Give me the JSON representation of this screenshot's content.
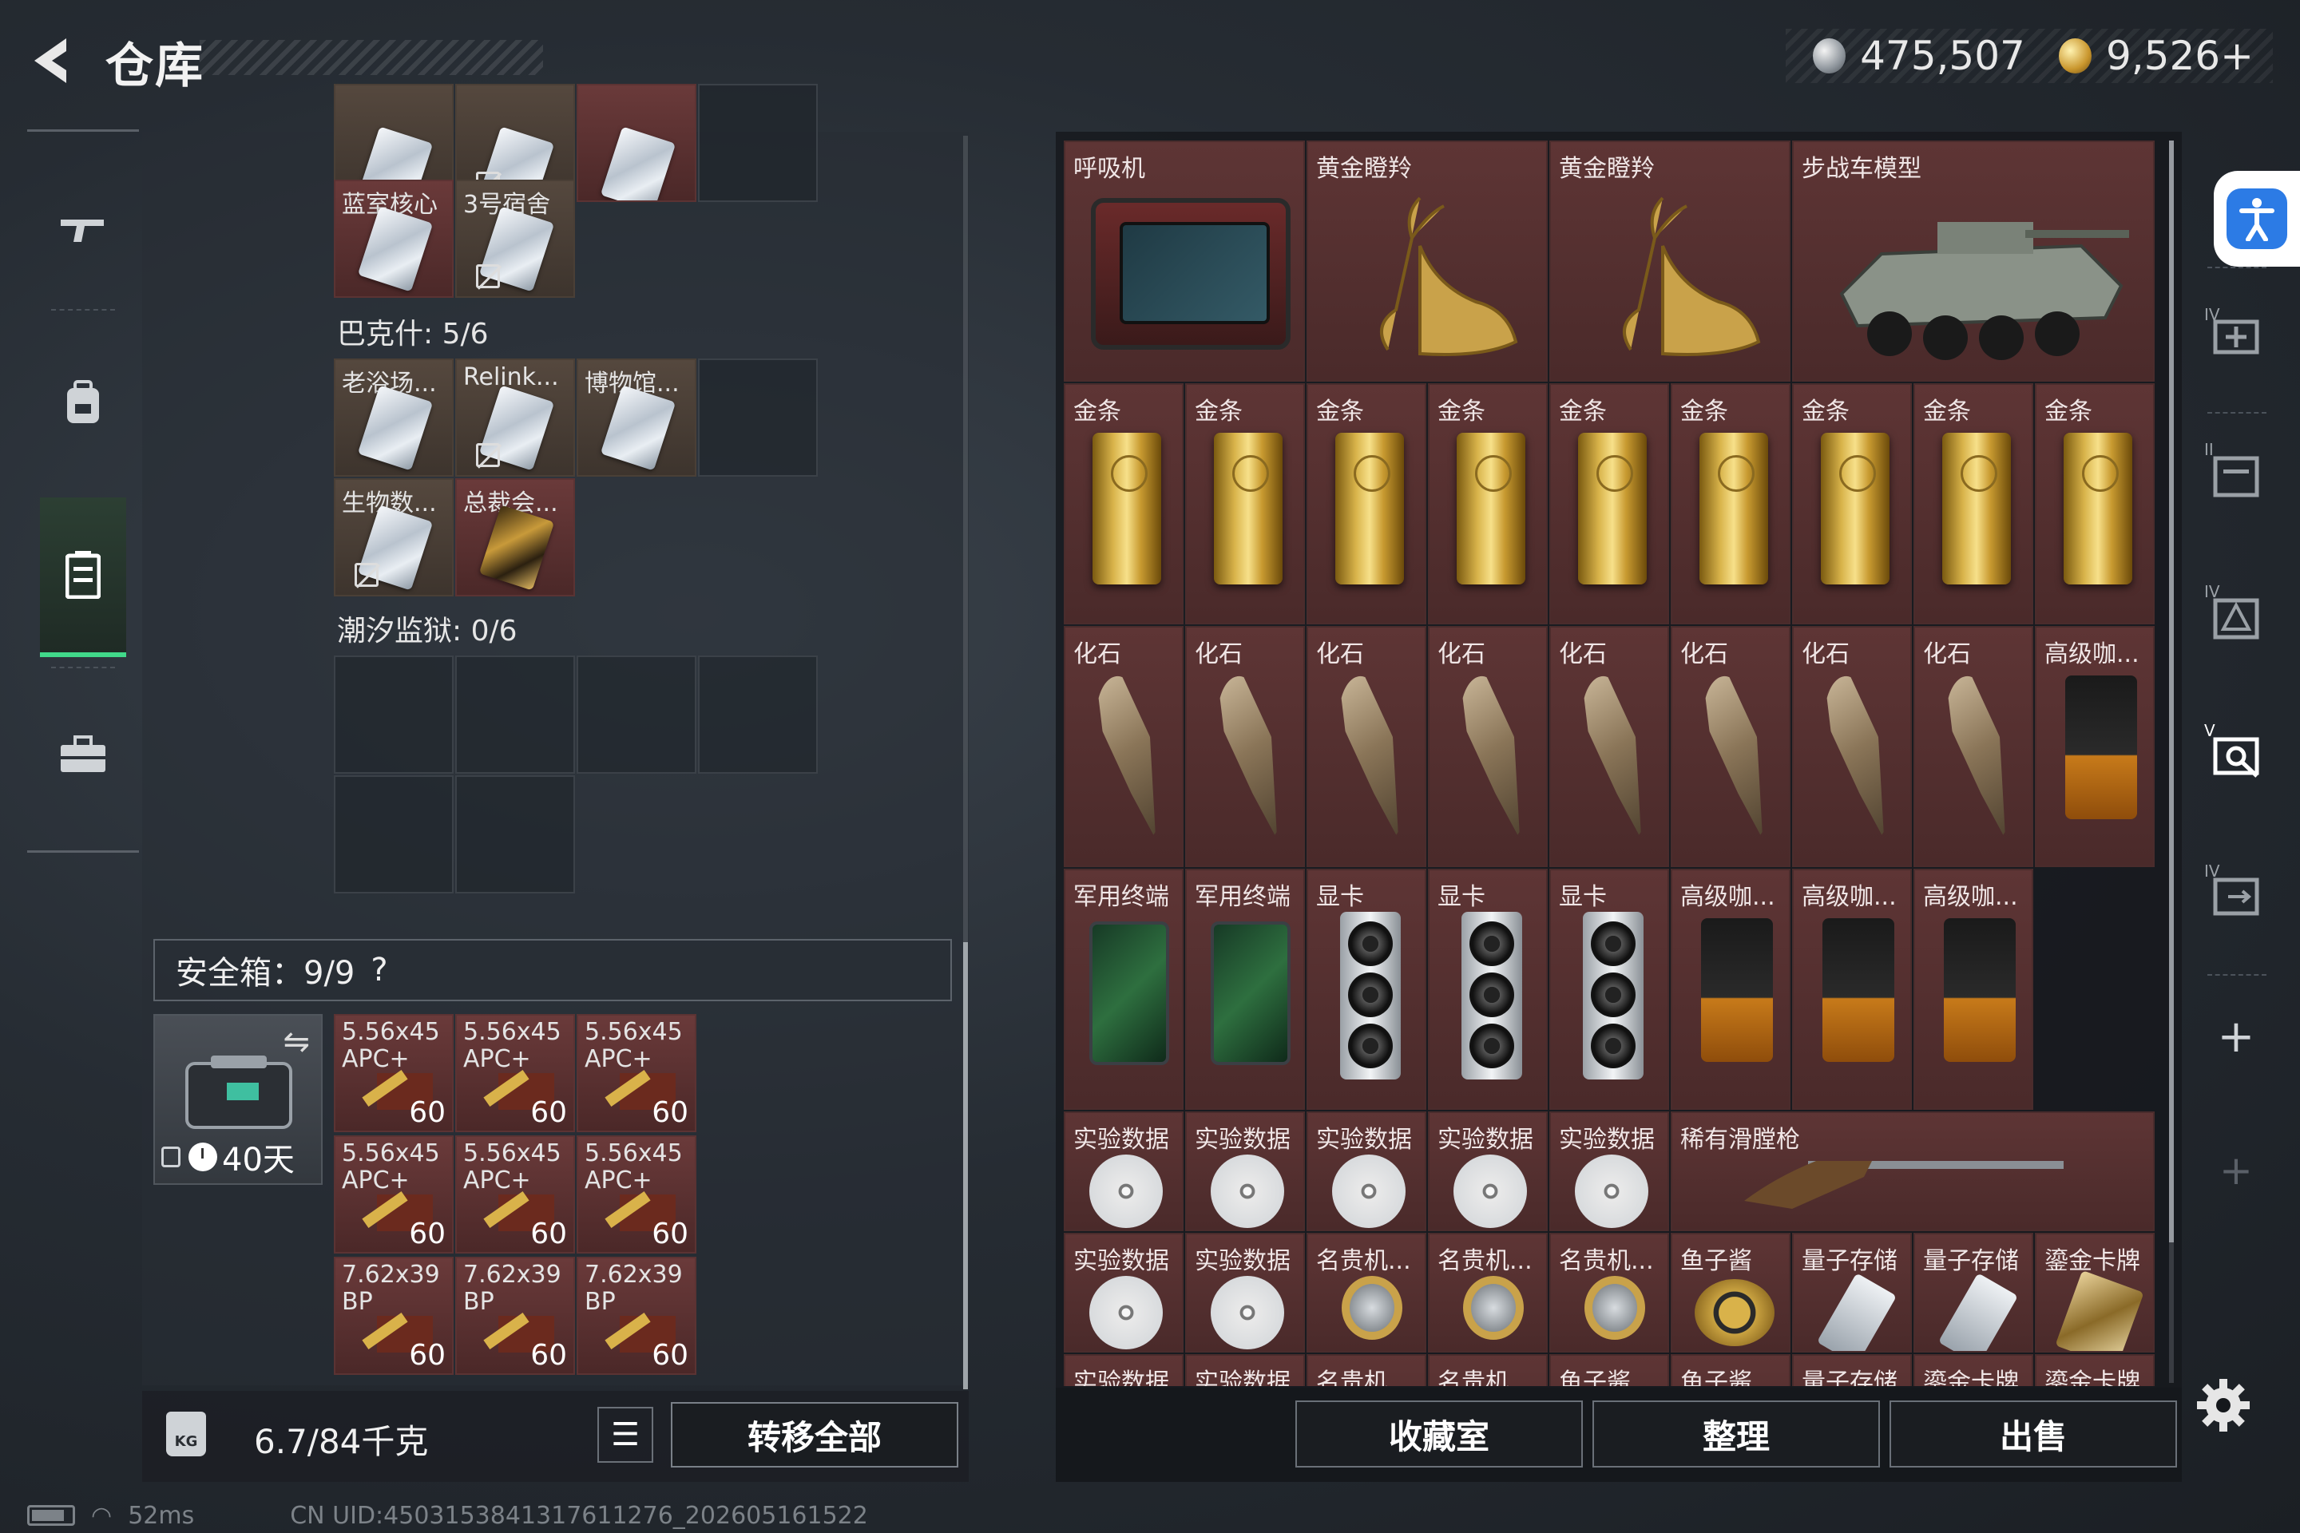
{
  "header": {
    "title": "仓库",
    "currency": [
      {
        "icon": "silver-coin-icon",
        "value": "475,507"
      },
      {
        "icon": "gold-coin-icon",
        "value": "9,526+"
      }
    ]
  },
  "nav": [
    "gun-icon",
    "backpack-icon",
    "locker-icon",
    "briefcase-icon"
  ],
  "backpack": {
    "top_partial_items": [
      "",
      "",
      ""
    ],
    "keys_top": [
      {
        "label": "蓝室核心",
        "unbound": false
      },
      {
        "label": "3号宿舍",
        "unbound": true
      }
    ],
    "group_baxx": "巴克什: 5/6",
    "keys_baxx": [
      {
        "label": "老浴场...",
        "unbound": false
      },
      {
        "label": "Relink...",
        "unbound": true
      },
      {
        "label": "博物馆...",
        "unbound": false
      },
      {
        "label": "生物数...",
        "unbound": true
      },
      {
        "label": "总裁会...",
        "unbound": false
      }
    ],
    "group_chaoxi": "潮汐监狱: 0/6",
    "safe_header": "安全箱：9/9",
    "safe_help": "?",
    "safe_timer": "40天",
    "ammo": [
      {
        "label": "5.56x45 APC+",
        "count": "60"
      },
      {
        "label": "5.56x45 APC+",
        "count": "60"
      },
      {
        "label": "5.56x45 APC+",
        "count": "60"
      },
      {
        "label": "5.56x45 APC+",
        "count": "60"
      },
      {
        "label": "5.56x45 APC+",
        "count": "60"
      },
      {
        "label": "5.56x45 APC+",
        "count": "60"
      },
      {
        "label": "7.62x39 BP",
        "count": "60"
      },
      {
        "label": "7.62x39 BP",
        "count": "60"
      },
      {
        "label": "7.62x39 BP",
        "count": "60"
      }
    ],
    "weight": "6.7/84千克",
    "weight_icon_text": "KG",
    "transfer_all": "转移全部"
  },
  "storage": {
    "row1": [
      "呼吸机",
      "黄金瞪羚",
      "黄金瞪羚",
      "步战车模型"
    ],
    "row2": [
      "金条",
      "金条",
      "金条",
      "金条",
      "金条",
      "金条",
      "金条",
      "金条",
      "金条"
    ],
    "row3": [
      "化石",
      "化石",
      "化石",
      "化石",
      "化石",
      "化石",
      "化石",
      "化石",
      "高级咖..."
    ],
    "row4": [
      "军用终端",
      "军用终端",
      "显卡",
      "显卡",
      "显卡",
      "高级咖...",
      "高级咖...",
      "高级咖..."
    ],
    "row5": [
      "实验数据",
      "实验数据",
      "实验数据",
      "实验数据",
      "实验数据",
      "稀有滑膛枪"
    ],
    "row6": [
      "实验数据",
      "实验数据",
      "名贵机...",
      "名贵机...",
      "名贵机...",
      "鱼子酱",
      "量子存储",
      "量子存储",
      "鎏金卡牌"
    ],
    "row7": [
      "实验数据",
      "实验数据",
      "名贵机...",
      "名贵机...",
      "鱼子酱",
      "鱼子酱",
      "量子存储",
      "鎏金卡牌",
      "鎏金卡牌"
    ],
    "buttons": [
      "收藏室",
      "整理",
      "出售"
    ]
  },
  "status_bar": {
    "ping": "52ms",
    "uid": "CN UID:4503153841317611276_202605161522"
  },
  "colors": {
    "accent_green": "#41d98a",
    "storage_cell": "#5e3535",
    "accessibility_blue": "#2c7be5"
  }
}
